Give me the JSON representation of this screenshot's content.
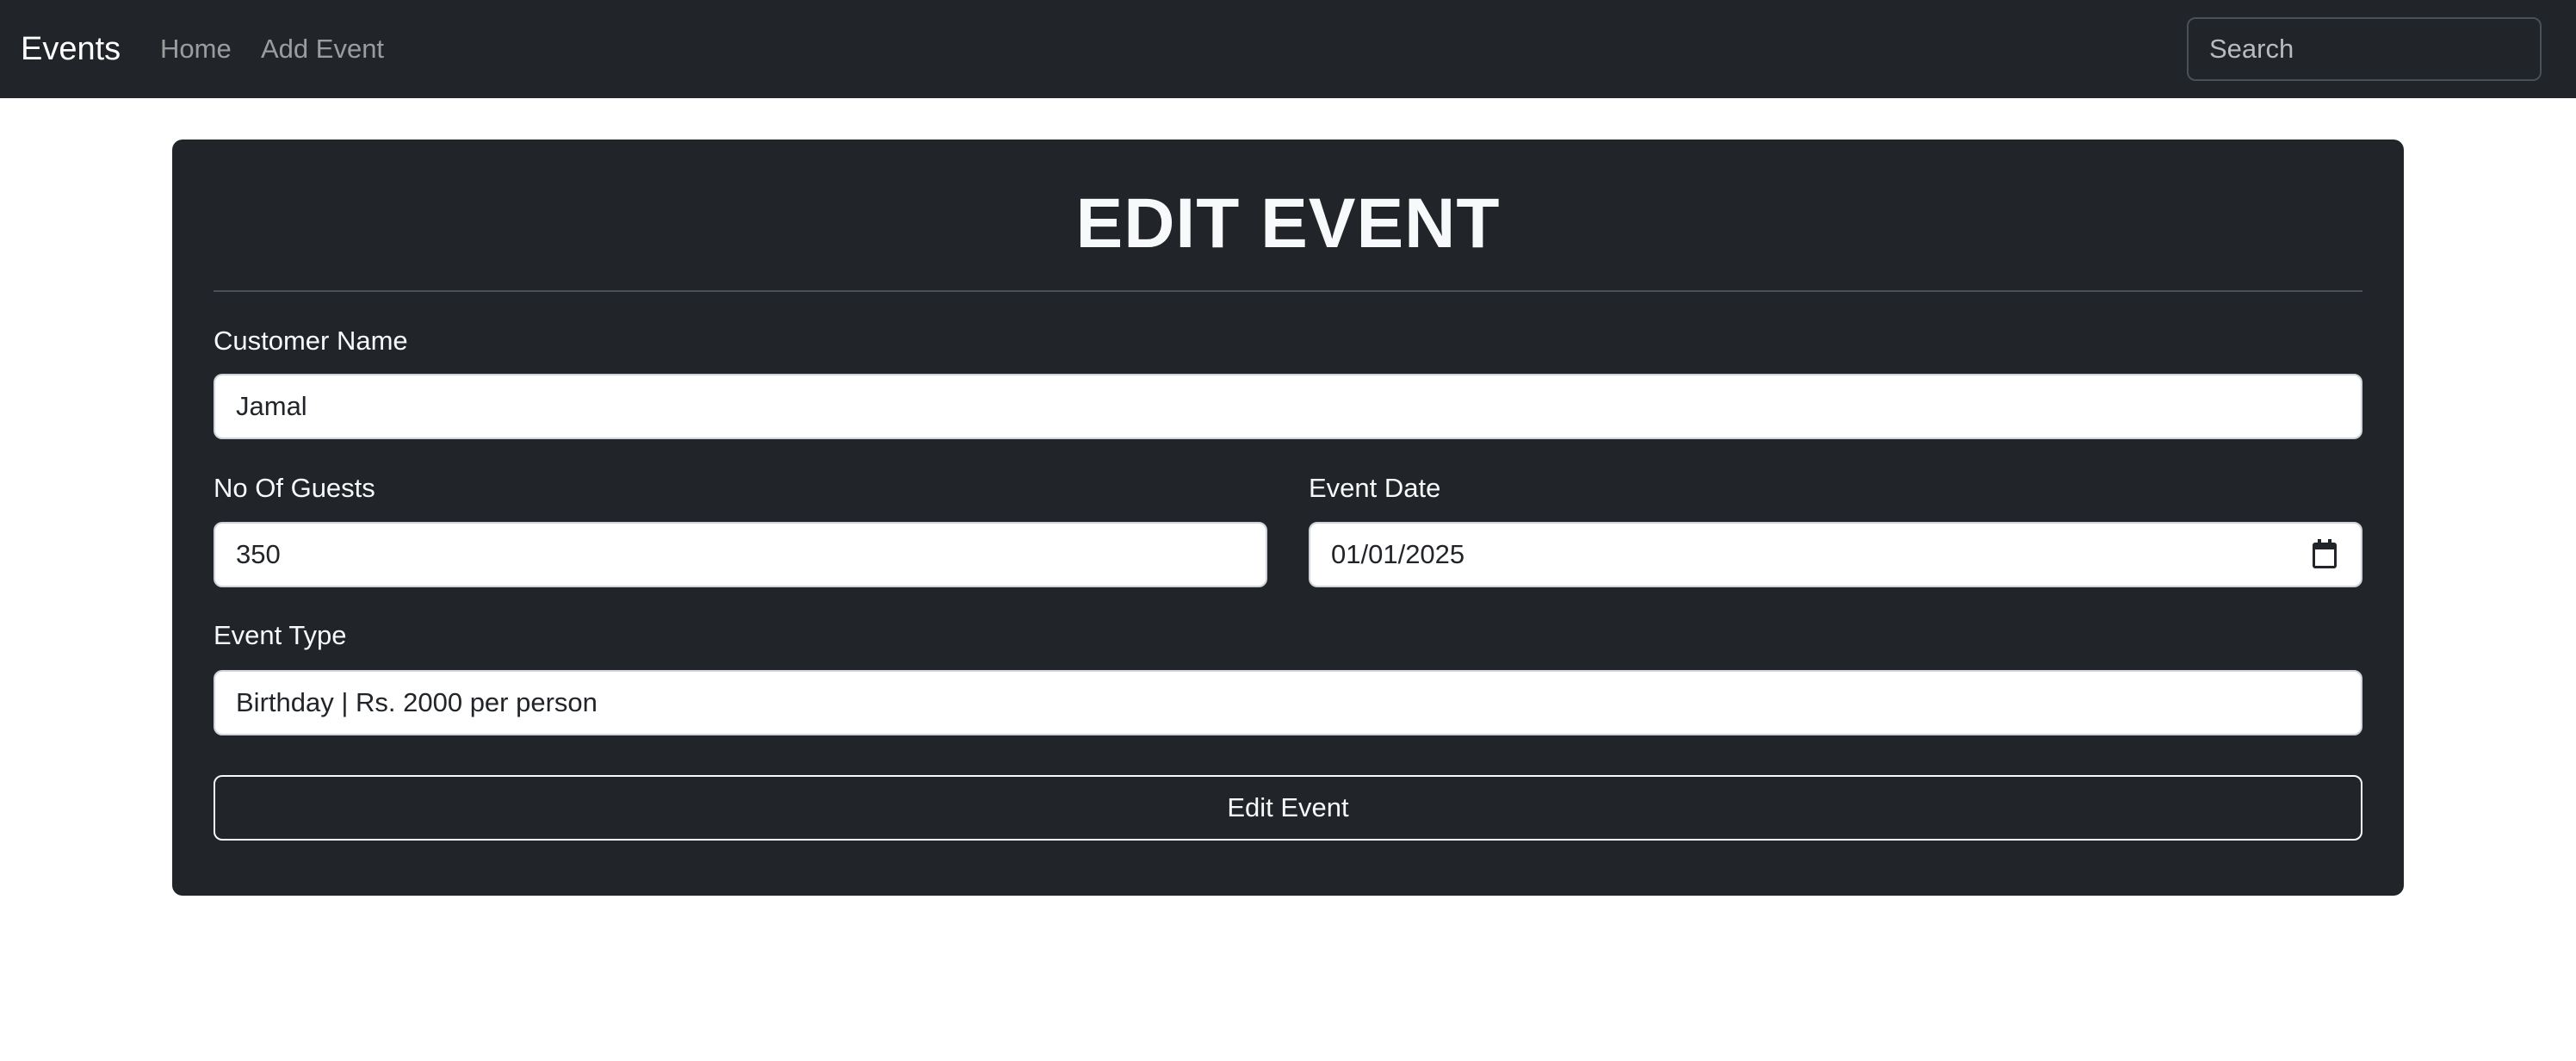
{
  "navbar": {
    "brand": "Events",
    "links": [
      {
        "label": "Home"
      },
      {
        "label": "Add Event"
      }
    ],
    "search_placeholder": "Search"
  },
  "card": {
    "title": "EDIT EVENT",
    "customer_name": {
      "label": "Customer Name",
      "value": "Jamal"
    },
    "guests": {
      "label": "No Of Guests",
      "value": "350"
    },
    "event_date": {
      "label": "Event Date",
      "value": "01/01/2025",
      "icon": "calendar-icon"
    },
    "event_type": {
      "label": "Event Type",
      "value": "Birthday | Rs. 2000 per person"
    },
    "submit_label": "Edit Event"
  },
  "colors": {
    "navbar_bg": "#212529",
    "card_bg": "#212529",
    "text_light": "#f8f9fa"
  }
}
